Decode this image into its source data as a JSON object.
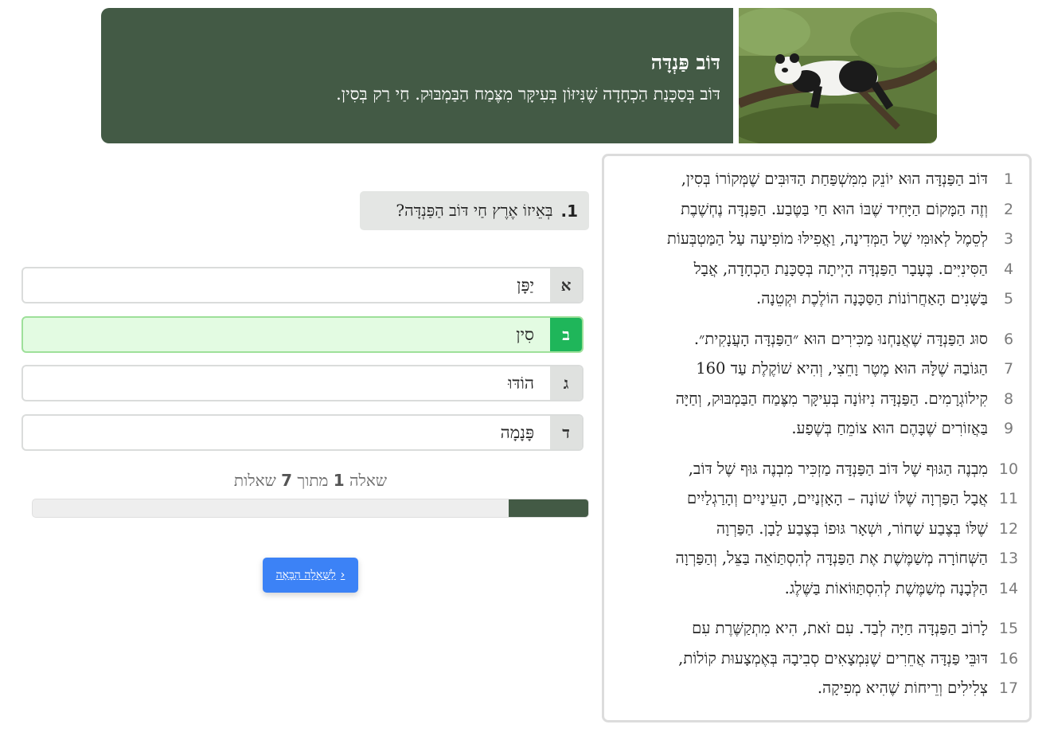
{
  "header": {
    "title": "דּוֹב פַּנְדָּה",
    "subtitle": "דּוֹב בְּסַכָּנַת הַכְחָדָה שֶׁנִּיזּוֹן בְּעִיקָּר מִצֶּמַח הַבַּמְבּוּק. חַי רַק בְּסִין."
  },
  "passage": {
    "lines": [
      {
        "n": "1",
        "text": "דּוֹב הַפַּנְדָּה הוּא יוֹנֵק מִמִּשְׁפַּחַת הַדּוּבִּים שֶׁמְּקוֹרוֹ בְּסִין,"
      },
      {
        "n": "2",
        "text": "וְזֶה הַמָּקוֹם הַיָּחִיד שֶׁבּוֹ הוּא חַי בַּטֶּבַע. הַפַּנְדָּה נֶחְשֶׁבֶת"
      },
      {
        "n": "3",
        "text": "לְסֵמֶל לְאוּמִּי שֶׁל הַמְּדִינָה, וַאֲפִילּוּ מוֹפִיעָה עַל הַמַּטְבְּעוֹת"
      },
      {
        "n": "4",
        "text": "הַסִּינִיִּים. בֶּעָבָר הַפַּנְדָּה הָיְיתָה בְּסַכָּנַת הַכְחָדָה, אֲבָל"
      },
      {
        "n": "5",
        "text": "בַּשָּׁנִים הָאַחֲרוֹנוֹת הַסַּכָּנָה הוֹלֶכֶת וּקְטֵנָה."
      },
      {
        "n": "6",
        "text": "סוּג הַפַּנְדָּה שֶׁאֲנַחְנוּ מַכִּירִים הוּא ״הַפַּנְדָּה הָעֲנָקִית״."
      },
      {
        "n": "7",
        "text": "הַגּוֹבַהּ שֶׁלָּהּ הוּא מֶטֶר וָחֵצִי, וְהִיא שׁוֹקֶלֶת עַד 160"
      },
      {
        "n": "8",
        "text": "קִילוֹגְרָמִים. הַפַּנְדָּה נִיזּוֹנָה בְּעִיקָּר מִצֶּמַח הַבַּמְבּוּק, וְחַיָּה"
      },
      {
        "n": "9",
        "text": "בַּאֲזוֹרִים שֶׁבָּהֶם הוּא צוֹמֵחַ בְּשֶׁפַע."
      },
      {
        "n": "10",
        "text": "מִבְנֶה הַגּוּף שֶׁל דּוֹב הַפַּנְדָּה מַזְכִּיר מִבְנֶה גּוּף שֶׁל דּוֹב,"
      },
      {
        "n": "11",
        "text": "אֲבָל הַפַּרְוָה שֶׁלּוֹ שׁוֹנָה – הָאָזְנַיִים, הָעֵינַיִים וְהָרַגְלַיִים"
      },
      {
        "n": "12",
        "text": "שֶׁלּוֹ בְּצֶבַע שָׁחוֹר, וּשְׁאָר גּוּפוֹ בְּצֶבַע לָבָן. הַפַּרְוָה"
      },
      {
        "n": "13",
        "text": "הַשְּׁחוֹרָה מְשַׁמֶּשֶׁת אֶת הַפַּנְדָּה לְהִסְתַּוֹאֵה בַּצֵּל, וְהַפַּרְוָה"
      },
      {
        "n": "14",
        "text": "הַלְּבָנָה מְשַׁמֶּשֶׁת לְהִסְתַּוּוֹאוֹת בַּשֶּׁלֶג."
      },
      {
        "n": "15",
        "text": "לָרוֹב הַפַּנְדָּה חַיָּה לְבַד. עִם זֹאת, הִיא מִתְקַשֶּׁרֶת עִם"
      },
      {
        "n": "16",
        "text": "דּוּבֵּי פַּנְדָּה אֲחֵרִים שֶׁנִּמְצָאִים סְבִיבָהּ בְּאֶמְצָעוּת קוֹלוֹת,"
      },
      {
        "n": "17",
        "text": "צְלִילִים וְרֵיחוֹת שֶׁהִיא מְפִיקָה."
      }
    ]
  },
  "question": {
    "number": "1.",
    "text": "בְּאֵיזוֹ אֶרֶץ חַי דּוֹב הַפַּנְדָּה?"
  },
  "answers": [
    {
      "letter": "א",
      "text": "יַפָּן"
    },
    {
      "letter": "ב",
      "text": "סִין",
      "state": "correct"
    },
    {
      "letter": "ג",
      "text": "הוֹדּוּ"
    },
    {
      "letter": "ד",
      "text": "פָּנָמָה"
    }
  ],
  "progress": {
    "prefix": "שאלה",
    "current": "1",
    "middle": "מתוך",
    "total": "7",
    "suffix": "שאלות",
    "fraction": 0.142857
  },
  "next_button": {
    "label": "לַשְּׁאֵלָה הַבָּאָה",
    "chevron": "‹"
  },
  "colors": {
    "brand_green": "#435a45",
    "correct_green": "#1fb65a",
    "correct_bg": "#e3fbe2",
    "button_blue": "#3c82f6"
  }
}
